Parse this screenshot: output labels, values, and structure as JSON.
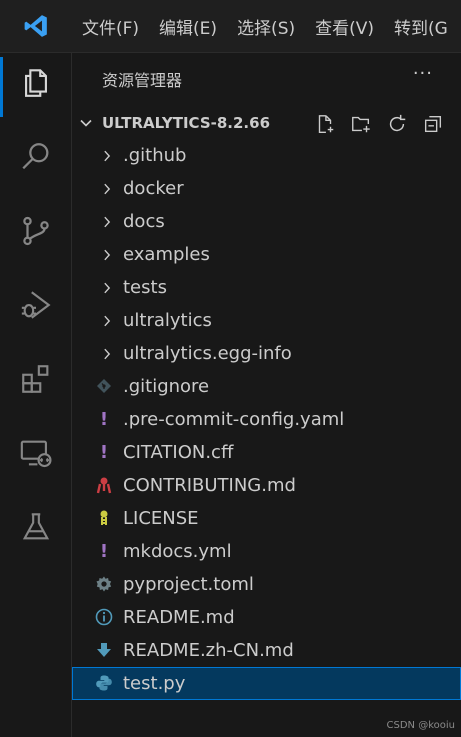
{
  "menu": [
    "文件(F)",
    "编辑(E)",
    "选择(S)",
    "查看(V)",
    "转到(G"
  ],
  "explorer": {
    "title": "资源管理器",
    "more_label": "···",
    "folder_name": "ULTRALYTICS-8.2.66"
  },
  "items": [
    {
      "label": ".github",
      "kind": "folder"
    },
    {
      "label": "docker",
      "kind": "folder"
    },
    {
      "label": "docs",
      "kind": "folder"
    },
    {
      "label": "examples",
      "kind": "folder"
    },
    {
      "label": "tests",
      "kind": "folder"
    },
    {
      "label": "ultralytics",
      "kind": "folder"
    },
    {
      "label": "ultralytics.egg-info",
      "kind": "folder"
    },
    {
      "label": ".gitignore",
      "kind": "git-icon"
    },
    {
      "label": ".pre-commit-config.yaml",
      "kind": "yaml-icon"
    },
    {
      "label": "CITATION.cff",
      "kind": "yaml-icon"
    },
    {
      "label": "CONTRIBUTING.md",
      "kind": "contributing-icon"
    },
    {
      "label": "LICENSE",
      "kind": "license-key-icon"
    },
    {
      "label": "mkdocs.yml",
      "kind": "yaml-icon"
    },
    {
      "label": "pyproject.toml",
      "kind": "gear-icon"
    },
    {
      "label": "README.md",
      "kind": "info-icon"
    },
    {
      "label": "README.zh-CN.md",
      "kind": "download-arrow-icon"
    },
    {
      "label": "test.py",
      "kind": "python-icon",
      "selected": true
    }
  ],
  "colors": {
    "accent": "#0078d4",
    "selection": "#04395e",
    "yaml": "#a074c4",
    "info": "#519aba",
    "python": "#519aba",
    "license": "#cbcb41",
    "contributing": "#cc3e44"
  },
  "watermark": "CSDN @kooiu"
}
